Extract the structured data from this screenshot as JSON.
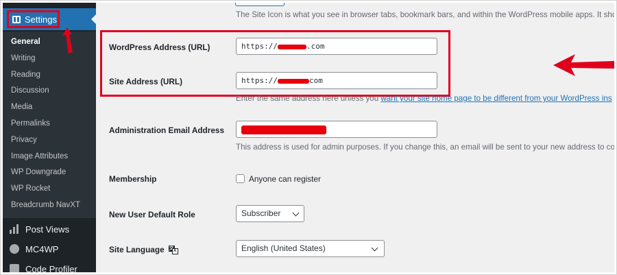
{
  "sidebar": {
    "active_menu": {
      "label": "Settings",
      "icon": "settings-icon"
    },
    "submenu": [
      {
        "label": "General",
        "current": true
      },
      {
        "label": "Writing"
      },
      {
        "label": "Reading"
      },
      {
        "label": "Discussion"
      },
      {
        "label": "Media"
      },
      {
        "label": "Permalinks"
      },
      {
        "label": "Privacy"
      },
      {
        "label": "Image Attributes"
      },
      {
        "label": "WP Downgrade"
      },
      {
        "label": "WP Rocket"
      },
      {
        "label": "Breadcrumb NavXT"
      }
    ],
    "menu": [
      {
        "label": "Post Views",
        "icon": "bar-chart-icon"
      },
      {
        "label": "MC4WP",
        "icon": "mc4wp-icon"
      },
      {
        "label": "Code Profiler",
        "icon": "gauge-icon"
      }
    ]
  },
  "form": {
    "site_icon_desc": "The Site Icon is what you see in browser tabs, bookmark bars, and within the WordPress mobile apps. It sho",
    "wp_address": {
      "label": "WordPress Address (URL)",
      "value_prefix": "https://",
      "value_suffix": ".com"
    },
    "site_address": {
      "label": "Site Address (URL)",
      "value_prefix": "https://",
      "value_suffix": "com",
      "desc_before": "Enter the same address here unless you ",
      "desc_link": "want your site home page to be different from your WordPress ins"
    },
    "admin_email": {
      "label": "Administration Email Address",
      "desc": "This address is used for admin purposes. If you change this, an email will be sent to your new address to co"
    },
    "membership": {
      "label": "Membership",
      "checkbox_label": "Anyone can register",
      "checked": false
    },
    "default_role": {
      "label": "New User Default Role",
      "value": "Subscriber"
    },
    "site_language": {
      "label": "Site Language",
      "value": "English (United States)",
      "icon": "translate-icon"
    }
  },
  "annotations": {
    "highlight_color": "#e0001b",
    "redaction_color": "#e8000d"
  },
  "colors": {
    "sidebar_bg": "#1d2327",
    "submenu_bg": "#2c3338",
    "accent": "#2271b1",
    "content_bg": "#f0f0f1"
  }
}
